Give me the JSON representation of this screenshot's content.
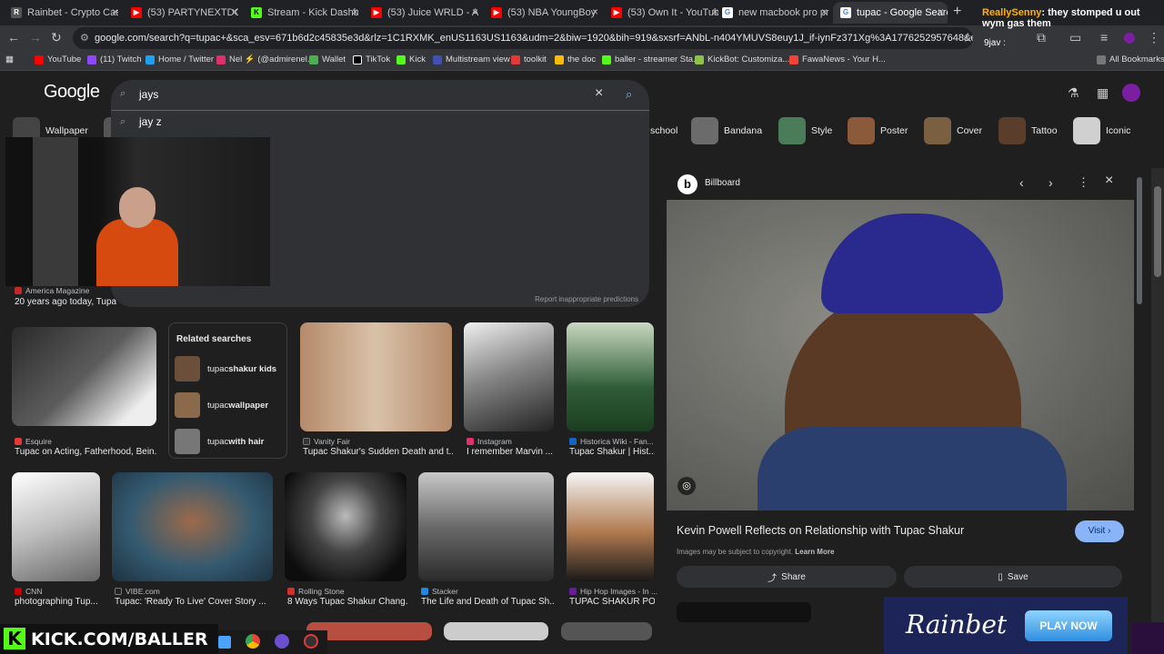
{
  "tabs": [
    {
      "title": "Rainbet - Crypto Casino",
      "icon": "R",
      "color": "#555"
    },
    {
      "title": "(53) PARTYNEXTDOOR",
      "icon": "▶",
      "color": "#ff0000"
    },
    {
      "title": "Stream - Kick Dashboard",
      "icon": "K",
      "color": "#53fc18"
    },
    {
      "title": "(53) Juice WRLD - All G",
      "icon": "▶",
      "color": "#ff0000"
    },
    {
      "title": "(53) NBA YoungBoy - F",
      "icon": "▶",
      "color": "#ff0000"
    },
    {
      "title": "(53) Own It - YouTube",
      "icon": "▶",
      "color": "#ff0000"
    },
    {
      "title": "new macbook pro pric",
      "icon": "G",
      "color": "#4285f4"
    },
    {
      "title": "tupac - Google Search",
      "icon": "G",
      "color": "#4285f4"
    }
  ],
  "url": "google.com/search?q=tupac+&sca_esv=671b6d2c45835e3d&rlz=1C1RXMK_enUS1163US1163&udm=2&biw=1920&bih=919&sxsrf=ANbL-n404YMUVS8euy1J_if-iynFz371Xg%3A1776252957648&ei=HXjfaeeiJ-ic0PEP-YTH4QU&...",
  "bookmarks": [
    {
      "label": "YouTube",
      "color": "#ff0000"
    },
    {
      "label": "(11) Twitch",
      "color": "#9146ff"
    },
    {
      "label": "Home / Twitter",
      "color": "#1da1f2"
    },
    {
      "label": "Nel ⚡ (@admirenel...",
      "color": "#e1306c"
    },
    {
      "label": "Wallet",
      "color": "#4caf50"
    },
    {
      "label": "TikTok",
      "color": "#000000"
    },
    {
      "label": "Kick",
      "color": "#53fc18"
    },
    {
      "label": "Multistream view",
      "color": "#3f51b5"
    },
    {
      "label": "toolkit",
      "color": "#e53935"
    },
    {
      "label": "the doc",
      "color": "#fbbc04"
    },
    {
      "label": "baller - streamer Sta...",
      "color": "#53fc18"
    },
    {
      "label": "KickBot: Customiza...",
      "color": "#8bc34a"
    },
    {
      "label": "FawaNews - Your H...",
      "color": "#f44336"
    }
  ],
  "all_bookmarks": "All Bookmarks",
  "google_logo": "Google",
  "search": {
    "query": "jays",
    "suggestion1": "jay z",
    "report": "Report inappropriate predictions"
  },
  "chips": [
    {
      "label": "Wallpaper"
    },
    {
      "label": "school"
    },
    {
      "label": "Bandana"
    },
    {
      "label": "Style"
    },
    {
      "label": "Poster"
    },
    {
      "label": "Cover"
    },
    {
      "label": "Tattoo"
    },
    {
      "label": "Iconic"
    }
  ],
  "results": [
    {
      "source": "America Magazine",
      "title": "20 years ago today, Tupac",
      "color": "#c62828"
    },
    {
      "source": "Esquire",
      "title": "Tupac on Acting, Fatherhood, Bein...",
      "color": "#e53935"
    },
    {
      "source": "Vanity Fair",
      "title": "Tupac Shakur's Sudden Death and t...",
      "color": "#333333"
    },
    {
      "source": "Instagram",
      "title": "I remember Marvin ...",
      "color": "#e1306c"
    },
    {
      "source": "Historica Wiki - Fan...",
      "title": "Tupac Shakur | Hist...",
      "color": "#1565c0"
    },
    {
      "source": "CNN",
      "title": "photographing Tup...",
      "color": "#cc0000"
    },
    {
      "source": "VIBE.com",
      "title": "Tupac: 'Ready To Live' Cover Story ...",
      "color": "#222222"
    },
    {
      "source": "Rolling Stone",
      "title": "8 Ways Tupac Shakur Chang...",
      "color": "#d32f2f"
    },
    {
      "source": "Stacker",
      "title": "The Life and Death of Tupac Sh...",
      "color": "#1e88e5"
    },
    {
      "source": "Hip Hop Images - In ...",
      "title": "TUPAC SHAKUR PO...",
      "color": "#6a1b9a"
    }
  ],
  "related": {
    "heading": "Related searches",
    "items": [
      {
        "prefix": "tupac",
        "suffix": " shakur kids"
      },
      {
        "prefix": "tupac",
        "suffix": " wallpaper"
      },
      {
        "prefix": "tupac",
        "suffix": " with hair"
      }
    ]
  },
  "panel": {
    "source": "Billboard",
    "title": "Kevin Powell Reflects on Relationship with Tupac Shakur",
    "visit": "Visit",
    "copyright": "Images may be subject to copyright.",
    "learn_more": "Learn More",
    "share": "Share",
    "save": "Save"
  },
  "overlays": {
    "kick": "KICK.COM/BALLER",
    "rainbet": "Rainbet",
    "play_now": "PLAY NOW",
    "chat_user": "ReallySenny",
    "chat_text": ": they stomped u out wym gas them",
    "chat_user2": "9jav :"
  }
}
